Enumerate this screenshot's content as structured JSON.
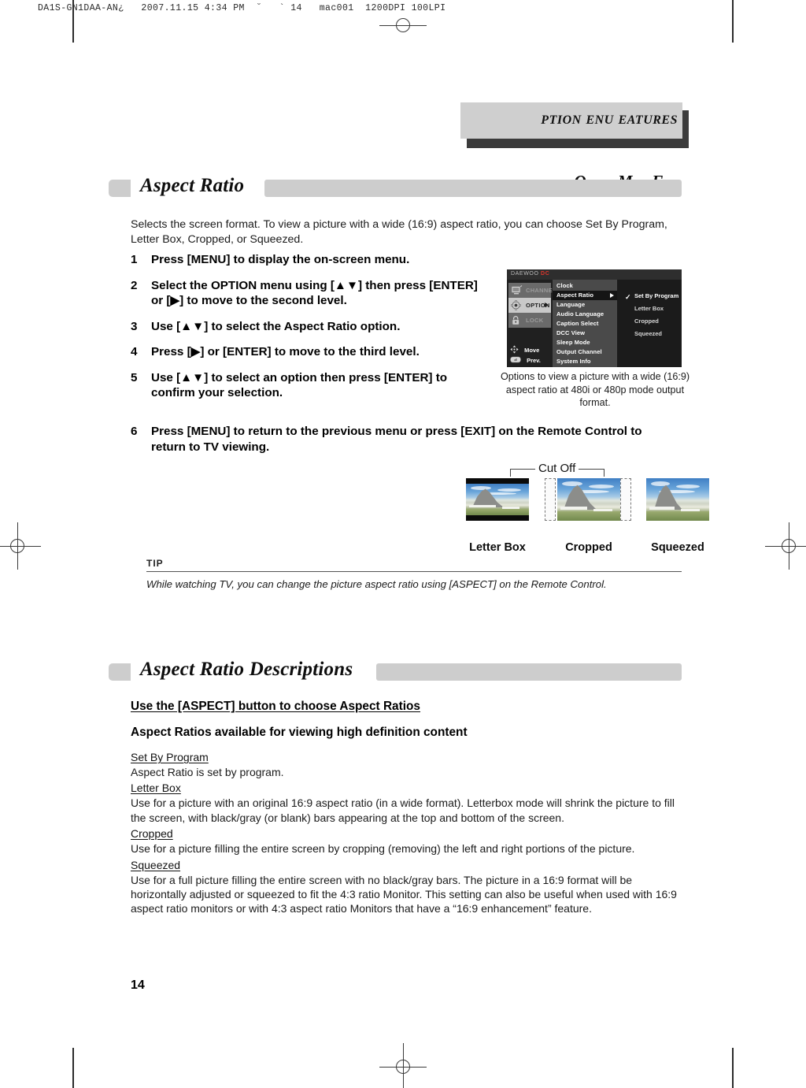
{
  "slug": "DA1S-GN1DAA-AN¿   2007.11.15 4:34 PM  ˘   ` 14   mac001  1200DPI 100LPI",
  "running_head": {
    "word1_cap": "O",
    "word1": "PTION",
    "word2_cap": "M",
    "word2": "ENU",
    "word3_cap": "F",
    "word3": "EATURES"
  },
  "section1": {
    "title": "Aspect Ratio",
    "intro": "Selects the screen format. To view a picture with a wide (16:9) aspect ratio, you can choose Set By Program, Letter Box, Cropped, or Squeezed.",
    "steps": [
      {
        "num": "1",
        "text": "Press [MENU] to display the on-screen menu."
      },
      {
        "num": "2",
        "text": "Select the OPTION menu using [▲▼] then press [ENTER] or [▶] to move to the second level."
      },
      {
        "num": "3",
        "text": "Use [▲▼] to select the Aspect Ratio option."
      },
      {
        "num": "4",
        "text": "Press [▶] or [ENTER] to move to the third level."
      },
      {
        "num": "5",
        "text": "Use [▲▼] to select an option then press [ENTER] to confirm your selection."
      },
      {
        "num": "6",
        "text": "Press [MENU] to return to the previous menu or press [EXIT] on the Remote Control to return to TV viewing."
      }
    ]
  },
  "osd": {
    "brand": "DAEWOO",
    "brand_mark": "DC",
    "sidebar": [
      {
        "label": "CHANNEL",
        "icon": "tv-icon",
        "state": "dim"
      },
      {
        "label": "OPTION",
        "icon": "gear-icon",
        "state": "selected"
      },
      {
        "label": "LOCK",
        "icon": "lock-icon",
        "state": "dim"
      }
    ],
    "helpers": [
      {
        "label": "Move",
        "icon": "four-way-arrow-icon"
      },
      {
        "label": "Prev.",
        "icon": "prev-button-icon"
      }
    ],
    "level2": [
      {
        "label": "Clock",
        "highlighted": false
      },
      {
        "label": "Aspect Ratio",
        "highlighted": true
      },
      {
        "label": "Language",
        "highlighted": false
      },
      {
        "label": "Audio Language",
        "highlighted": false
      },
      {
        "label": "Caption Select",
        "highlighted": false
      },
      {
        "label": "DCC View",
        "highlighted": false
      },
      {
        "label": "Sleep Mode",
        "highlighted": false
      },
      {
        "label": "Output Channel",
        "highlighted": false
      },
      {
        "label": "System Info",
        "highlighted": false
      }
    ],
    "level3": [
      {
        "label": "Set By Program",
        "checked": true
      },
      {
        "label": "Letter Box",
        "checked": false
      },
      {
        "label": "Cropped",
        "checked": false
      },
      {
        "label": "Squeezed",
        "checked": false
      }
    ],
    "caption": "Options to view a picture with a wide (16:9) aspect ratio at 480i or 480p mode output format."
  },
  "samples": {
    "cut_off_label": "Cut Off",
    "items": [
      {
        "label": "Letter Box",
        "mode": "letterbox"
      },
      {
        "label": "Cropped",
        "mode": "cropped"
      },
      {
        "label": "Squeezed",
        "mode": "squeezed"
      }
    ]
  },
  "tip": {
    "label": "TIP",
    "text": "While watching TV, you can change the picture aspect ratio using [ASPECT] on the Remote Control."
  },
  "section2": {
    "title": "Aspect Ratio Descriptions",
    "heading_underlined": "Use the [ASPECT] button to choose Aspect Ratios",
    "heading_plain": "Aspect Ratios available for viewing high definition content",
    "entries": [
      {
        "term": "Set By Program",
        "body": "Aspect Ratio is set by program."
      },
      {
        "term": "Letter Box",
        "body": "Use for a picture with an original 16:9 aspect ratio (in a wide format). Letterbox mode will shrink the picture to fill the screen, with black/gray (or blank) bars appearing at the top and bottom of the screen."
      },
      {
        "term": "Cropped",
        "body": "Use for a picture filling the entire screen by cropping (removing) the left and right portions of the picture."
      },
      {
        "term": "Squeezed",
        "body": "Use for a full picture filling the entire screen with no black/gray bars. The picture in a 16:9 format will be horizontally adjusted or squeezed to fit the 4:3 ratio Monitor. This setting can also be useful when used with 16:9 aspect ratio monitors or with 4:3 aspect ratio Monitors that have a “16:9 enhancement” feature."
      }
    ]
  },
  "page_number": "14",
  "colors": {
    "band_gray": "#cdcdcd",
    "head_shadow": "#3b3b3b",
    "osd_bg": "#1b1b1b",
    "accent_red": "#e0362c"
  }
}
